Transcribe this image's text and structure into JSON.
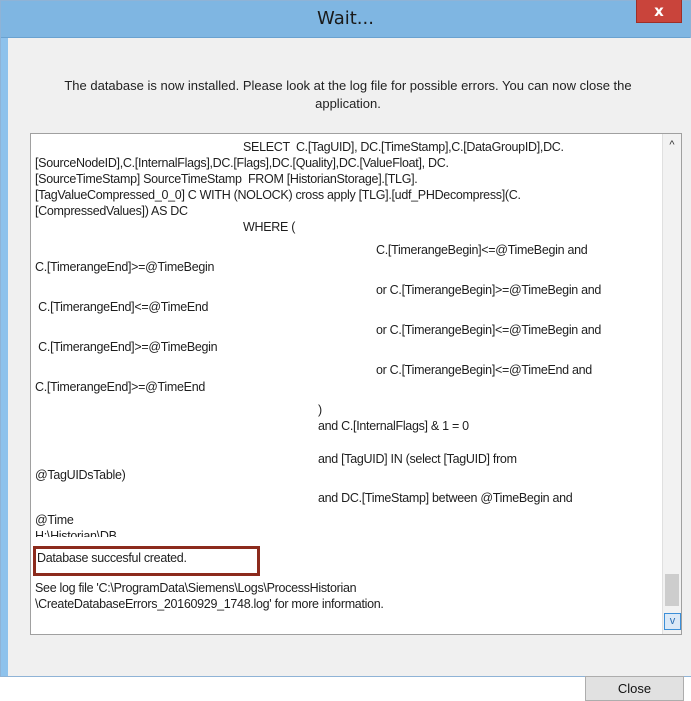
{
  "window": {
    "title": "Wait...",
    "close_glyph": "x"
  },
  "message": "The database is now installed. Please look at the log file for possible errors. You can now close the application.",
  "log": {
    "lines": [
      "SELECT  C.[TagUID], DC.[TimeStamp],C.[DataGroupID],DC.",
      "[SourceNodeID],C.[InternalFlags],DC.[Flags],DC.[Quality],DC.[ValueFloat], DC.",
      "[SourceTimeStamp] SourceTimeStamp  FROM [HistorianStorage].[TLG].",
      "[TagValueCompressed_0_0] C WITH (NOLOCK) cross apply [TLG].[udf_PHDecompress](C.",
      "[CompressedValues]) AS DC",
      "WHERE (",
      "C.[TimerangeBegin]<=@TimeBegin and",
      "C.[TimerangeEnd]>=@TimeBegin",
      "or C.[TimerangeBegin]>=@TimeBegin and",
      " C.[TimerangeEnd]<=@TimeEnd",
      "or C.[TimerangeBegin]<=@TimeBegin and",
      " C.[TimerangeEnd]>=@TimeBegin",
      "or C.[TimerangeBegin]<=@TimeEnd and",
      "C.[TimerangeEnd]>=@TimeEnd",
      ")",
      "and C.[InternalFlags] & 1 = 0",
      "and [TagUID] IN (select [TagUID] from",
      "@TagUIDsTable)",
      "and DC.[TimeStamp] between @TimeBegin and",
      "@Time",
      "H:\\Historian\\DB",
      "Database succesful created.",
      "See log file 'C:\\ProgramData\\Siemens\\Logs\\ProcessHistorian",
      "\\CreateDatabaseErrors_20160929_1748.log' for more information."
    ]
  },
  "scrollbar": {
    "up_glyph": "^",
    "down_glyph": "v"
  },
  "buttons": {
    "close_label": "Close"
  }
}
